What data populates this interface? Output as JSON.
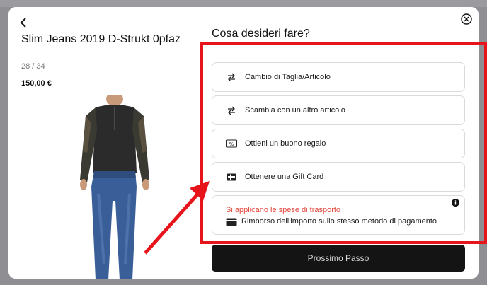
{
  "product": {
    "name": "Slim Jeans 2019 D-Strukt 0pfaz",
    "size": "28 / 34",
    "price": "150,00 €"
  },
  "question": "Cosa desideri fare?",
  "options": [
    {
      "label": "Cambio di Taglia/Articolo",
      "icon": "swap-arrows-icon"
    },
    {
      "label": "Scambia con un altro articolo",
      "icon": "swap-arrows-icon"
    },
    {
      "label": "Ottieni un buono regalo",
      "icon": "voucher-icon"
    },
    {
      "label": "Ottenere una Gift Card",
      "icon": "gift-card-icon"
    }
  ],
  "refund": {
    "warning": "Si applicano le spese di trasporto",
    "label": "Rimborso dell'importo sullo stesso metodo di pagamento",
    "warning_color": "#e2453a"
  },
  "next_button": "Prossimo Passo",
  "annotation_color": "#e8141b",
  "voucher_icon_text": "%"
}
